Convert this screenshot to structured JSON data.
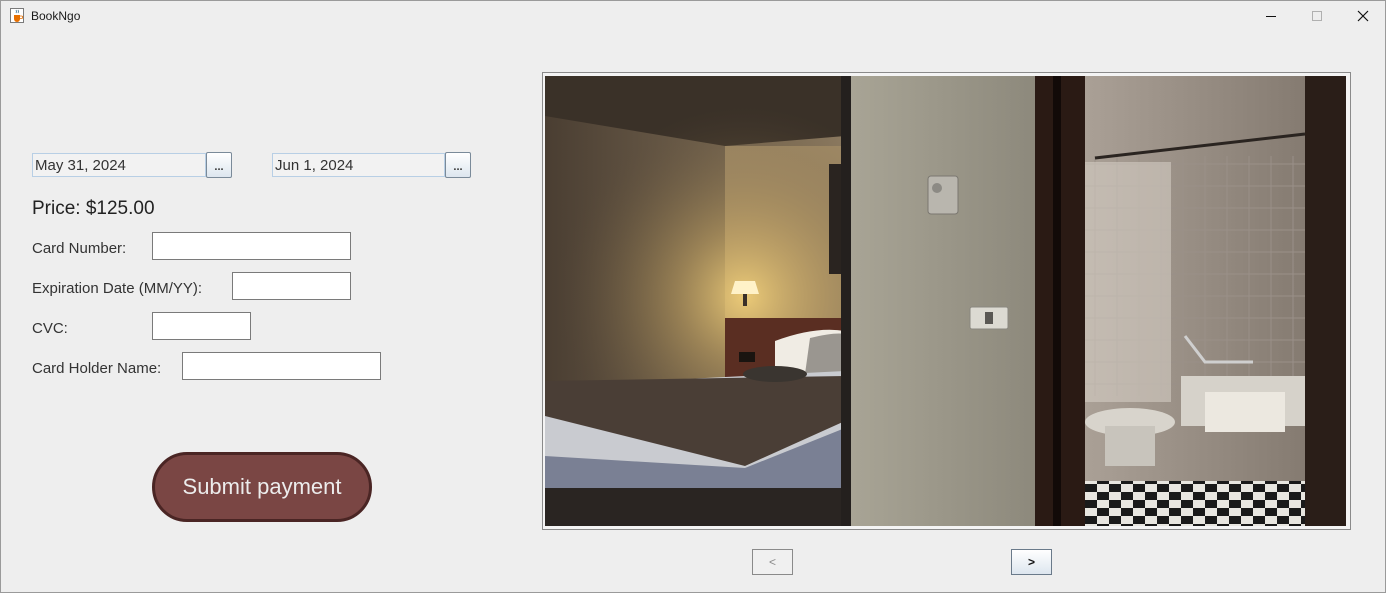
{
  "window": {
    "title": "BookNgo",
    "icons": {
      "app": "java-cup-icon",
      "minimize": "minimize-icon",
      "maximize": "maximize-icon",
      "close": "close-icon"
    }
  },
  "booking": {
    "check_in": "May 31, 2024",
    "check_out": "Jun 1, 2024",
    "date_button_label": "...",
    "price": "Price: $125.00"
  },
  "payment_form": {
    "card_number_label": "Card Number:",
    "card_number_value": "",
    "expiration_label": "Expiration Date (MM/YY):",
    "expiration_value": "",
    "cvc_label": "CVC:",
    "cvc_value": "",
    "holder_label": "Card Holder Name:",
    "holder_value": "",
    "submit_label": "Submit payment"
  },
  "gallery": {
    "image_description": "hotel-room-bed-and-bathroom-photo",
    "prev_label": "<",
    "next_label": ">"
  },
  "colors": {
    "submit_fill": "#7a4644",
    "submit_border": "#4a2524",
    "background": "#eeeeee"
  }
}
